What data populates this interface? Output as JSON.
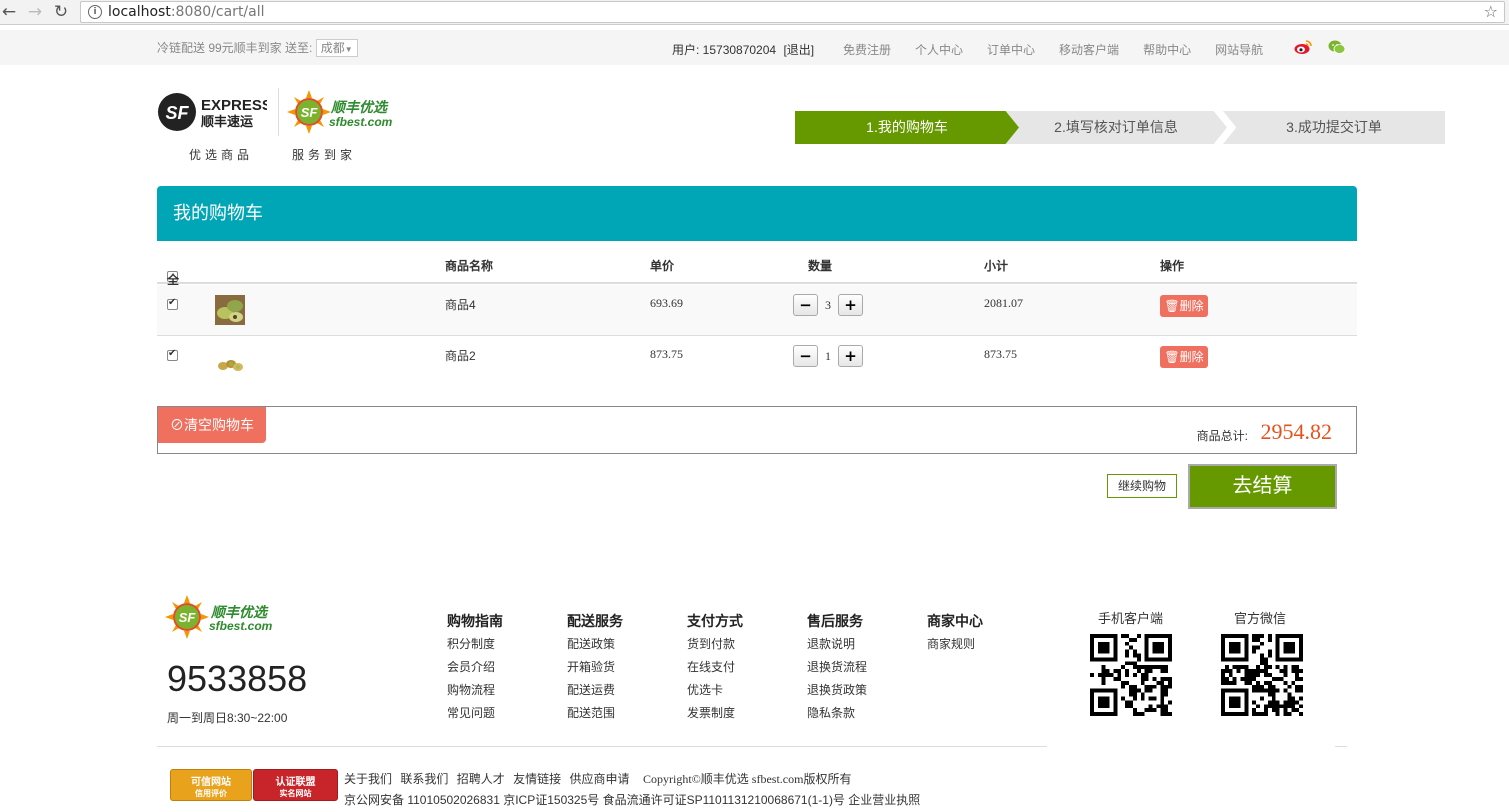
{
  "browser": {
    "url_host": "localhost",
    "url_path": ":8080/cart/all"
  },
  "topbar": {
    "promo": "冷链配送 99元顺丰到家 送至:",
    "city": "成都",
    "user": "用户: 15730870204",
    "logout": "[退出]",
    "links": [
      "免费注册",
      "个人中心",
      "订单中心",
      "移动客户端",
      "帮助中心",
      "网站导航"
    ]
  },
  "header": {
    "logo1_text": "EXPRESS",
    "logo1_sub": "顺丰速运",
    "logo2_text": "顺丰优选",
    "logo2_sub": "sfbest.com",
    "slogan1": "优选商品",
    "slogan2": "服务到家"
  },
  "steps": [
    "1.我的购物车",
    "2.填写核对订单信息",
    "3.成功提交订单"
  ],
  "cart": {
    "title": "我的购物车",
    "headers": {
      "select_all": "全选",
      "name": "商品名称",
      "price": "单价",
      "qty": "数量",
      "subtotal": "小计",
      "action": "操作"
    },
    "items": [
      {
        "name": "商品4",
        "price": "693.69",
        "qty": "3",
        "subtotal": "2081.07",
        "delete": "删除",
        "checked": true
      },
      {
        "name": "商品2",
        "price": "873.75",
        "qty": "1",
        "subtotal": "873.75",
        "delete": "删除",
        "checked": true
      }
    ],
    "clear_label": "清空购物车",
    "total_label": "商品总计:",
    "total_value": "2954.82",
    "continue_label": "继续购物",
    "checkout_label": "去结算"
  },
  "footer": {
    "logo_text": "顺丰优选",
    "logo_sub": "sfbest.com",
    "phone": "9533858",
    "hours": "周一到周日8:30~22:00",
    "columns": [
      {
        "title": "购物指南",
        "items": [
          "积分制度",
          "会员介绍",
          "购物流程",
          "常见问题"
        ]
      },
      {
        "title": "配送服务",
        "items": [
          "配送政策",
          "开箱验货",
          "配送运费",
          "配送范围"
        ]
      },
      {
        "title": "支付方式",
        "items": [
          "货到付款",
          "在线支付",
          "优选卡",
          "发票制度"
        ]
      },
      {
        "title": "售后服务",
        "items": [
          "退款说明",
          "退换货流程",
          "退换货政策",
          "隐私条款"
        ]
      },
      {
        "title": "商家中心",
        "items": [
          "商家规则"
        ]
      }
    ],
    "qr1_title": "手机客户端",
    "qr2_title": "官方微信",
    "badge1_top": "可信网站",
    "badge1_bottom": "信用评价",
    "badge2_top": "认证联盟",
    "badge2_bottom": "实名网站",
    "links": [
      "关于我们",
      "联系我们",
      "招聘人才",
      "友情链接",
      "供应商申请"
    ],
    "copyright": "Copyright©顺丰优选 sfbest.com版权所有",
    "icp": "京公网安备 11010502026831 京ICP证150325号 食品流通许可证SP1101131210068671(1-1)号 企业营业执照"
  },
  "colors": {
    "teal": "#00a6b5",
    "green": "#669900",
    "salmon": "#f0705f",
    "price_orange": "#e4521b"
  }
}
